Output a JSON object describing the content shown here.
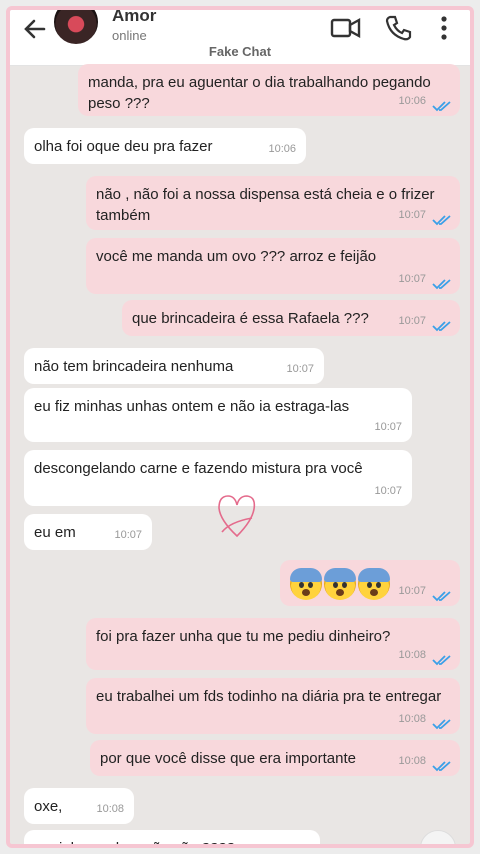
{
  "header": {
    "contact_name": "Amor",
    "status": "online",
    "watermark": "Fake Chat"
  },
  "colors": {
    "outgoing": "#f8d8dc",
    "incoming": "#ffffff",
    "tick_blue": "#3aa0e8",
    "frame": "#f6c6d2"
  },
  "messages": [
    {
      "dir": "out",
      "text": "manda, pra eu aguentar o dia trabalhando pegando peso ???",
      "time": "10:06",
      "read": true
    },
    {
      "dir": "in",
      "text": "olha foi oque deu pra fazer",
      "time": "10:06"
    },
    {
      "dir": "out",
      "text": "não , não foi a nossa dispensa está cheia e o frizer também",
      "time": "10:07",
      "read": true
    },
    {
      "dir": "out",
      "text": "você me manda um ovo ??? arroz e feijão",
      "time": "10:07",
      "read": true
    },
    {
      "dir": "out",
      "text": "que brincadeira é essa Rafaela ???",
      "time": "10:07",
      "read": true
    },
    {
      "dir": "in",
      "text": "não tem brincadeira nenhuma",
      "time": "10:07"
    },
    {
      "dir": "in",
      "text": "eu fiz minhas unhas ontem e não ia estraga-las",
      "time": "10:07"
    },
    {
      "dir": "in",
      "text": "descongelando carne e fazendo mistura pra você",
      "time": "10:07"
    },
    {
      "dir": "in",
      "text": "eu em",
      "time": "10:07"
    },
    {
      "dir": "out",
      "emoji": "fearful-face-emoji x3",
      "time": "10:07",
      "read": true
    },
    {
      "dir": "out",
      "text": "foi pra fazer unha que tu me pediu dinheiro?",
      "time": "10:08",
      "read": true
    },
    {
      "dir": "out",
      "text": "eu trabalhei um fds todinho na diária pra te entregar",
      "time": "10:08",
      "read": true
    },
    {
      "dir": "out",
      "text": "por que você disse que era importante",
      "time": "10:08",
      "read": true
    },
    {
      "dir": "in",
      "text": "oxe,",
      "time": "10:08"
    },
    {
      "dir": "in",
      "text": "e minhas unhas não são ????",
      "time": ""
    }
  ]
}
